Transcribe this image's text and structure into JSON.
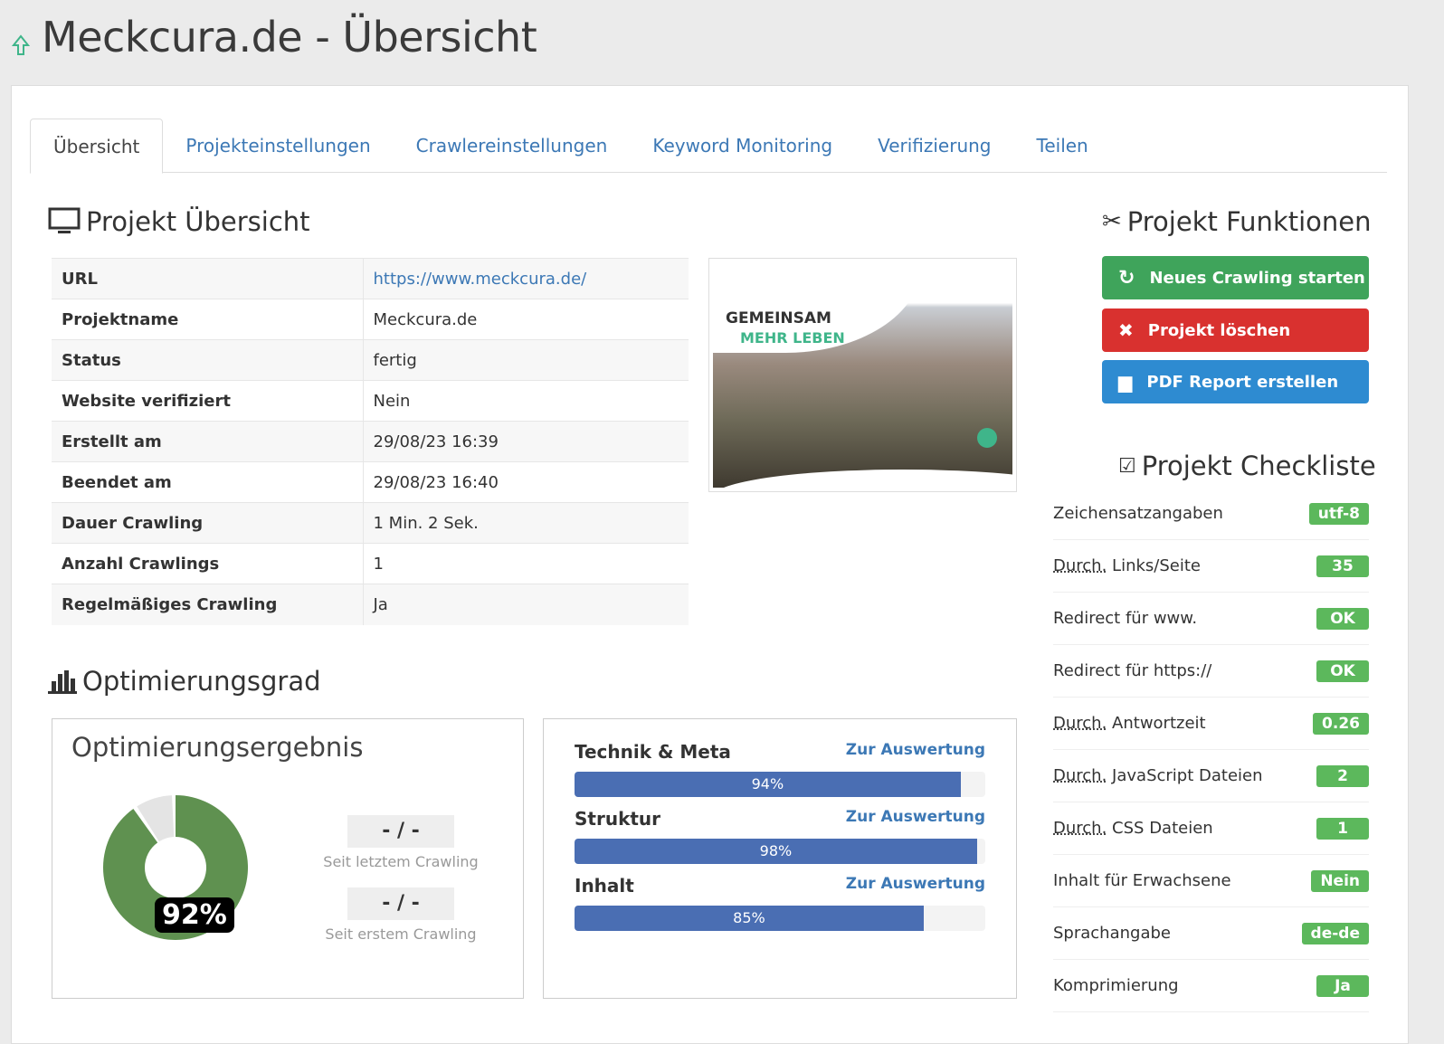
{
  "header": {
    "title": "Meckcura.de - Übersicht"
  },
  "tabs": [
    {
      "label": "Übersicht"
    },
    {
      "label": "Projekteinstellungen"
    },
    {
      "label": "Crawlereinstellungen"
    },
    {
      "label": "Keyword Monitoring"
    },
    {
      "label": "Verifizierung"
    },
    {
      "label": "Teilen"
    }
  ],
  "overview": {
    "title": "Projekt Übersicht",
    "rows": [
      {
        "key": "URL",
        "value": "https://www.meckcura.de/"
      },
      {
        "key": "Projektname",
        "value": "Meckcura.de"
      },
      {
        "key": "Status",
        "value": "fertig"
      },
      {
        "key": "Website verifiziert",
        "value": "Nein"
      },
      {
        "key": "Erstellt am",
        "value": "29/08/23 16:39"
      },
      {
        "key": "Beendet am",
        "value": "29/08/23 16:40"
      },
      {
        "key": "Dauer Crawling",
        "value": "1 Min. 2 Sek."
      },
      {
        "key": "Anzahl Crawlings",
        "value": "1"
      },
      {
        "key": "Regelmäßiges Crawling",
        "value": "Ja"
      }
    ]
  },
  "screenshot": {
    "line1": "GEMEINSAM",
    "line2": "MEHR LEBEN"
  },
  "functions": {
    "title": "Projekt Funktionen",
    "buttons": [
      {
        "label": "Neues Crawling starten",
        "color": "#3fa45b"
      },
      {
        "label": "Projekt löschen",
        "color": "#d9312f"
      },
      {
        "label": "PDF Report erstellen",
        "color": "#2e8bd1"
      }
    ]
  },
  "checklist": {
    "title": "Projekt Checkliste",
    "abbr": "Durch.",
    "items": [
      {
        "label": "Zeichensatzangaben",
        "value": "utf-8"
      },
      {
        "label": "Links/Seite",
        "abbr": true,
        "value": "35"
      },
      {
        "label": "Redirect für www.",
        "value": "OK"
      },
      {
        "label": "Redirect für https://",
        "value": "OK"
      },
      {
        "label": "Antwortzeit",
        "abbr": true,
        "value": "0.26"
      },
      {
        "label": "JavaScript Dateien",
        "abbr": true,
        "value": "2"
      },
      {
        "label": "CSS Dateien",
        "abbr": true,
        "value": "1"
      },
      {
        "label": "Inhalt für Erwachsene",
        "value": "Nein"
      },
      {
        "label": "Sprachangabe",
        "value": "de-de"
      },
      {
        "label": "Komprimierung",
        "value": "Ja"
      }
    ]
  },
  "optimization": {
    "title": "Optimierungsgrad",
    "result_title": "Optimierungsergebnis",
    "score": 92,
    "score_label": "92%",
    "since_last": {
      "value": "- / -",
      "label": "Seit letztem Crawling"
    },
    "since_first": {
      "value": "- / -",
      "label": "Seit erstem Crawling"
    },
    "categories": [
      {
        "label": "Technik & Meta",
        "link": "Zur Auswertung",
        "percent": 94,
        "percent_label": "94%"
      },
      {
        "label": "Struktur",
        "link": "Zur Auswertung",
        "percent": 98,
        "percent_label": "98%"
      },
      {
        "label": "Inhalt",
        "link": "Zur Auswertung",
        "percent": 85,
        "percent_label": "85%"
      }
    ]
  }
}
